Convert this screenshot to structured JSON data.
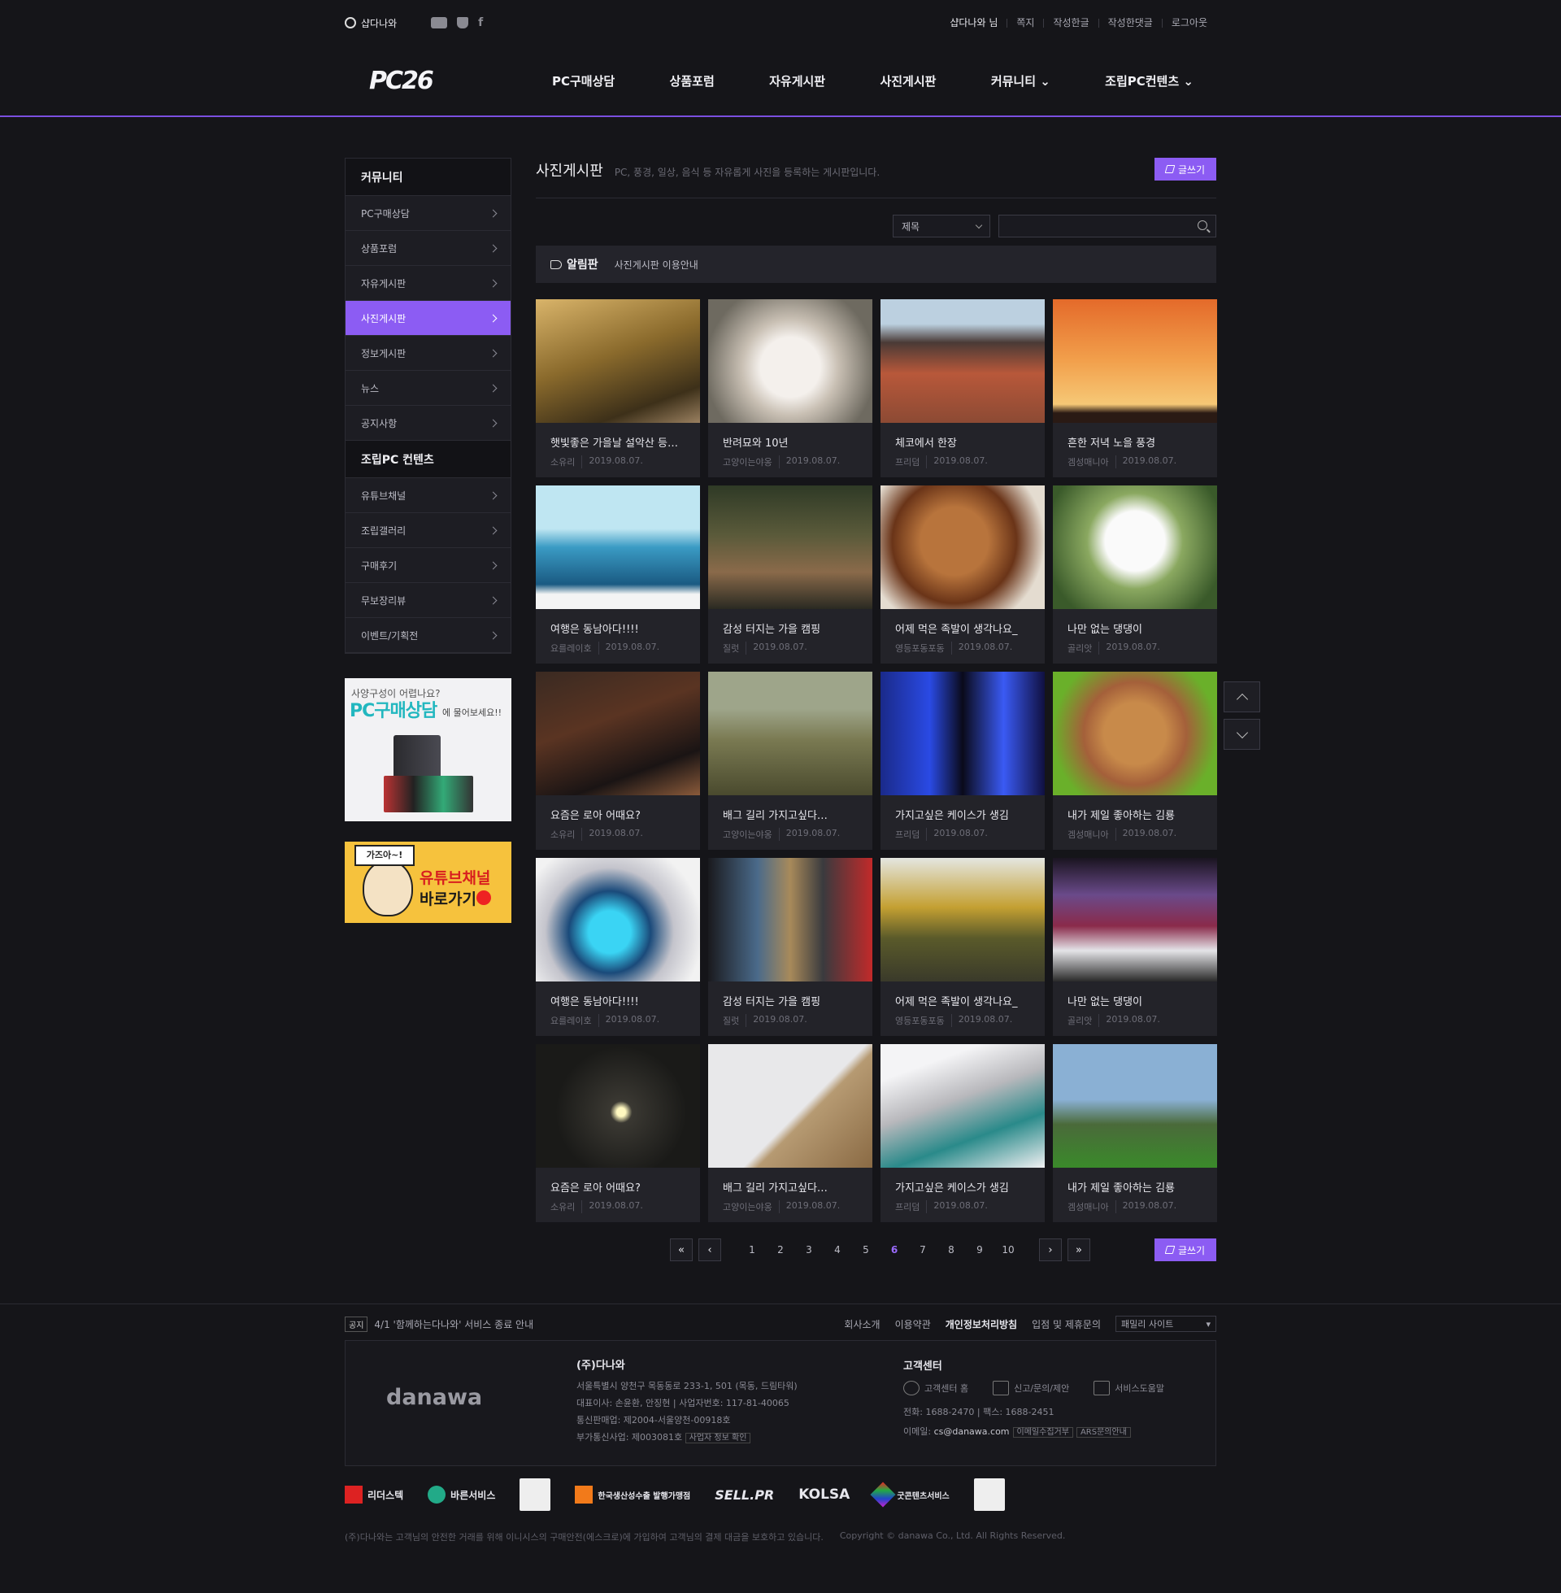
{
  "topbar": {
    "site": "샵다나와",
    "user": "샵다나와 님",
    "links": [
      "쪽지",
      "작성한글",
      "작성한댓글",
      "로그아웃"
    ]
  },
  "header": {
    "logo": "PC26",
    "nav": [
      "PC구매상담",
      "상품포럼",
      "자유게시판",
      "사진게시판",
      "커뮤니티 ⌄",
      "조립PC컨텐츠 ⌄"
    ]
  },
  "sidebar": {
    "community": {
      "title": "커뮤니티",
      "items": [
        "PC구매상담",
        "상품포럼",
        "자유게시판",
        "사진게시판",
        "정보게시판",
        "뉴스",
        "공지사항"
      ],
      "active": "사진게시판"
    },
    "pc_contents": {
      "title": "조립PC 컨텐츠",
      "items": [
        "유튜브채널",
        "조립갤러리",
        "구매후기",
        "무보장리뷰",
        "이벤트/기획전"
      ]
    },
    "banner1": {
      "line1": "사양구성이 어렵나요?",
      "line2": "PC구매상담",
      "line3": "에 물어보세요!!"
    },
    "banner2": {
      "sign": "가즈아~!",
      "line1": "유튜브채널",
      "line2": "바로가기"
    }
  },
  "main": {
    "title": "사진게시판",
    "description": "PC, 풍경, 일상, 음식 등 자유롭게 사진을 등록하는 게시판입니다.",
    "write_label": "글쓰기",
    "search": {
      "select": "제목",
      "placeholder": ""
    },
    "notice": {
      "label": "알림판",
      "text": "사진게시판 이용안내"
    },
    "posts": [
      {
        "title": "햇빛좋은 가을날 설악산 등…",
        "author": "소유리",
        "date": "2019.08.07.",
        "thumb": "linear-gradient(160deg,#d9b46a,#8a6a2c 45%,#3d3019 80%,#9a8060)"
      },
      {
        "title": "반려묘와 10년",
        "author": "고양이는야옹",
        "date": "2019.08.07.",
        "thumb": "radial-gradient(circle at 50% 55%,#f4f0ec 0 28%,#c9c0b4 45%,#6e6a60 80%)"
      },
      {
        "title": "체코에서 한장",
        "author": "프리덤",
        "date": "2019.08.07.",
        "thumb": "linear-gradient(180deg,#bcd0e0 0 20%,#4a3a36 35%,#b8583a 60%,#8c4a34 100%)"
      },
      {
        "title": "흔한 저녁 노을 풍경",
        "author": "겜성매니아",
        "date": "2019.08.07.",
        "thumb": "linear-gradient(180deg,#e46a2a,#f2a04c 50%,#f6c876 85%,#2a1a14 92%)"
      },
      {
        "title": "여행은 동남아다!!!!",
        "author": "요를레이호",
        "date": "2019.08.07.",
        "thumb": "linear-gradient(180deg,#bfe6f2 0 35%,#3a9bc4 50%,#1a5a82 80%,#f4f4f4 88%)"
      },
      {
        "title": "감성 터지는 가을 캠핑",
        "author": "질럿",
        "date": "2019.08.07.",
        "thumb": "linear-gradient(180deg,#2f3a26,#5a5a3a 40%,#8a6a4a 70%,#2a2a22)"
      },
      {
        "title": "어제 먹은 족발이 생각나요_",
        "author": "영등포동포동",
        "date": "2019.08.07.",
        "thumb": "radial-gradient(circle at 45% 45%,#b8743c 0 30%,#6a3418 55%,#e4dcd0 80%)"
      },
      {
        "title": "나만 없는 댕댕이",
        "author": "골리앗",
        "date": "2019.08.07.",
        "thumb": "radial-gradient(circle at 50% 45%,#fafafa 0 28%,#8aa860 45%,#3a5a2a 85%)"
      },
      {
        "title": "요즘은 로아 어때요?",
        "author": "소유리",
        "date": "2019.08.07.",
        "thumb": "linear-gradient(160deg,#3a2a22,#5a3422 40%,#1a1414 75%,#8a5a3a)"
      },
      {
        "title": "배그 길리 가지고싶다…",
        "author": "고양이는야옹",
        "date": "2019.08.07.",
        "thumb": "linear-gradient(180deg,#9ea58a 0 30%,#7a7a52 55%,#4a4a2e 100%)"
      },
      {
        "title": "가지고싶은 케이스가 생김",
        "author": "프리덤",
        "date": "2019.08.07.",
        "thumb": "linear-gradient(90deg,#1a2a8a,#2a4ae4 30%,#0a0a1a 50%,#3a5af4 75%,#101040)"
      },
      {
        "title": "내가 제일 좋아하는 김룡",
        "author": "겜성매니아",
        "date": "2019.08.07.",
        "thumb": "radial-gradient(circle at 50% 50%,#c88a4a 0 30%,#a4603a 50%,#6ab02a 80%)"
      },
      {
        "title": "여행은 동남아다!!!!",
        "author": "요를레이호",
        "date": "2019.08.07.",
        "thumb": "radial-gradient(circle at 45% 60%,#3ad4f4 0 18%,#1a4a7a 35%,#c4c4cc 55%,#f2f2f2 80%)"
      },
      {
        "title": "감성 터지는 가을 캠핑",
        "author": "질럿",
        "date": "2019.08.07.",
        "thumb": "linear-gradient(90deg,#1a1a1e,#4a6a8a 30%,#a88a5a 50%,#3a3a3e 70%,#c22a2a)"
      },
      {
        "title": "어제 먹은 족발이 생각나요_",
        "author": "영등포동포동",
        "date": "2019.08.07.",
        "thumb": "linear-gradient(180deg,#e4e6e0,#c4a032 40%,#5a5a2a 65%,#3a3a2a)"
      },
      {
        "title": "나만 없는 댕댕이",
        "author": "골리앗",
        "date": "2019.08.07.",
        "thumb": "linear-gradient(180deg,#1a1420,#6a4a8a 30%,#8a2a4a 55%,#e4e4e8 75%,#2a2a2a)"
      },
      {
        "title": "요즘은 로아 어때요?",
        "author": "소유리",
        "date": "2019.08.07.",
        "thumb": "radial-gradient(circle at 52% 55%,#fff8c0 0 4%,#3a3832 10%,#1a1a18 60%)"
      },
      {
        "title": "배그 길리 가지고싶다…",
        "author": "고양이는야옹",
        "date": "2019.08.07.",
        "thumb": "linear-gradient(135deg,#e8e8ea 0 55%,#b69a72 60%,#8a6a44 100%)"
      },
      {
        "title": "가지고싶은 케이스가 생김",
        "author": "프리덤",
        "date": "2019.08.07.",
        "thumb": "linear-gradient(160deg,#f4f4f6 0 20%,#b8b8bc 45%,#2a8a8a 70%,#f0f0f2 100%)"
      },
      {
        "title": "내가 제일 좋아하는 김룡",
        "author": "겜성매니아",
        "date": "2019.08.07.",
        "thumb": "linear-gradient(180deg,#8ab0d4 0 45%,#4a6a3a 65%,#3a8a2a 100%)"
      }
    ],
    "pagination": {
      "pages": [
        "1",
        "2",
        "3",
        "4",
        "5",
        "6",
        "7",
        "8",
        "9",
        "10"
      ],
      "current": "6",
      "first": "«",
      "prev": "‹",
      "next": "›",
      "last": "»"
    }
  },
  "footer": {
    "notice_tag": "공지",
    "notice_text": "4/1 '함께하는다나와' 서비스 종료 안내",
    "links": [
      "회사소개",
      "이용약관",
      "개인정보처리방침",
      "입점 및 제휴문의"
    ],
    "family_site": "패밀리 사이트",
    "logo": "danawa",
    "company": {
      "name": "(주)다나와",
      "addr": "서울특별시 양천구 목동동로 233-1, 501 (목동, 드림타워)",
      "ceo": "대표이사: 손윤환, 안징현",
      "biz": "사업자번호: 117-81-40065",
      "mail_order": "통신판매업: 제2004-서울양천-00918호",
      "vas": "부가통신사업: 제003081호",
      "biz_check": "사업자 정보 확인"
    },
    "cs": {
      "title": "고객센터",
      "links": [
        "고객센터 홈",
        "신고/문의/제안",
        "서비스도움말"
      ],
      "phone": "전화: 1688-2470",
      "fax": "팩스: 1688-2451",
      "email_label": "이메일:",
      "email": "cs@danawa.com",
      "refuse": "이메일수집거부",
      "ars": "ARS문의안내"
    },
    "certs": [
      "리더스텍",
      "바른서비스",
      "한국생산성수출 발행가맹점",
      "SELL.PR",
      "KOLSA",
      "굿콘텐츠서비스"
    ],
    "copy1": "(주)다나와는 고객님의 안전한 거래를 위해 이니시스의 구매안전(에스크로)에 가입하여 고객님의 결제 대금을 보호하고 있습니다.",
    "copy2": "Copyright © danawa Co., Ltd. All Rights Reserved."
  }
}
